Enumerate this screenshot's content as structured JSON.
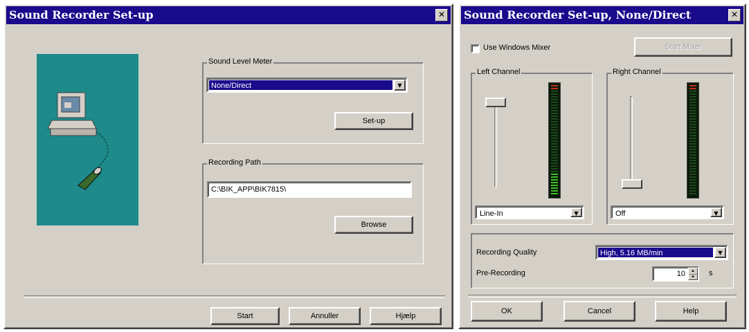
{
  "left_dialog": {
    "title": "Sound Recorder Set-up",
    "close_glyph": "✕",
    "sound_level_meter": {
      "group_label": "Sound Level Meter",
      "selected": "None/Direct",
      "setup_button": "Set-up"
    },
    "recording_path": {
      "group_label": "Recording Path",
      "value": "C:\\BIK_APP\\BIK7815\\",
      "browse_button": "Browse"
    },
    "footer": {
      "start_button": "Start",
      "cancel_button": "Annuller",
      "help_button": "Hjælp"
    }
  },
  "right_dialog": {
    "title": "Sound Recorder Set-up, None/Direct",
    "close_glyph": "✕",
    "use_windows_mixer_label": "Use Windows Mixer",
    "mixer_button": "Start Mixer",
    "left_channel": {
      "group_label": "Left Channel",
      "input": "Line-In",
      "meter_level": 0.2
    },
    "right_channel": {
      "group_label": "Right Channel",
      "input": "Off",
      "meter_level": 0.0
    },
    "recording_quality": {
      "label": "Recording Quality",
      "selected": "High, 5.16 MB/min"
    },
    "pre_recording": {
      "label": "Pre-Recording",
      "value": "10",
      "unit": "s"
    },
    "footer": {
      "ok_button": "OK",
      "cancel_button": "Cancel",
      "help_button": "Help"
    }
  },
  "colors": {
    "title_bar": "#1a0a8c",
    "dialog_face": "#d4d0c8",
    "illustration_bg": "#1e8a8a",
    "meter_on": "#3fbf2a",
    "meter_off": "#1c4a1c",
    "meter_peak": "#c03020"
  }
}
